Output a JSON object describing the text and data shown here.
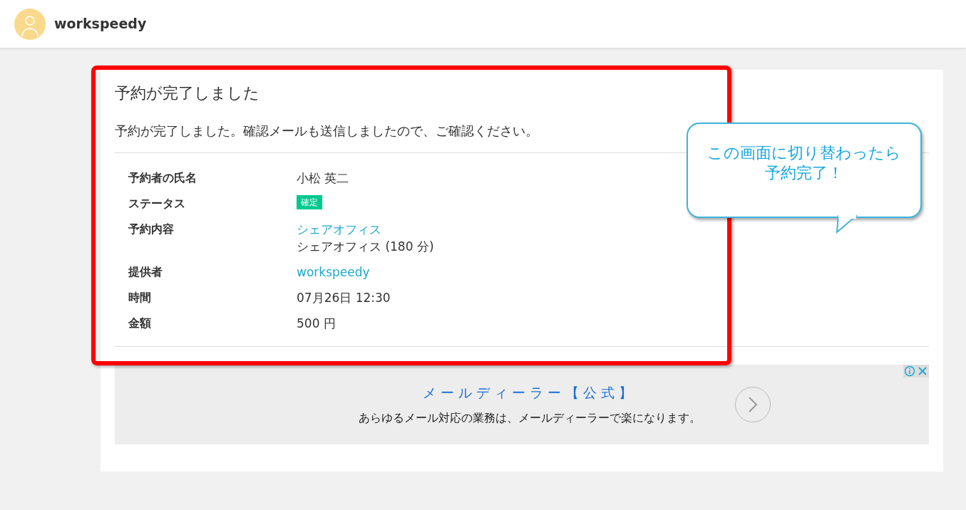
{
  "header": {
    "site_name": "workspeedy"
  },
  "confirmation": {
    "title": "予約が完了しました",
    "message": "予約が完了しました。確認メールも送信しましたので、ご確認ください。",
    "rows": [
      {
        "label": "予約者の氏名",
        "values": [
          {
            "kind": "text",
            "text": "小松 英二"
          }
        ]
      },
      {
        "label": "ステータス",
        "values": [
          {
            "kind": "badge",
            "text": "確定"
          }
        ]
      },
      {
        "label": "予約内容",
        "values": [
          {
            "kind": "link",
            "text": "シェアオフィス"
          },
          {
            "kind": "text",
            "text": "シェアオフィス (180 分)"
          }
        ]
      },
      {
        "label": "提供者",
        "values": [
          {
            "kind": "link",
            "text": "workspeedy"
          }
        ]
      },
      {
        "label": "時間",
        "values": [
          {
            "kind": "text",
            "text": "07月26日 12:30"
          }
        ]
      },
      {
        "label": "金額",
        "values": [
          {
            "kind": "text",
            "text": "500 円"
          }
        ]
      }
    ]
  },
  "ad": {
    "title": "メールディーラー【公式】",
    "text": "あらゆるメール対応の業務は、メールディーラーで楽になります。"
  },
  "callout": {
    "lines": [
      "この画面に切り替わったら",
      "予約完了！"
    ]
  }
}
